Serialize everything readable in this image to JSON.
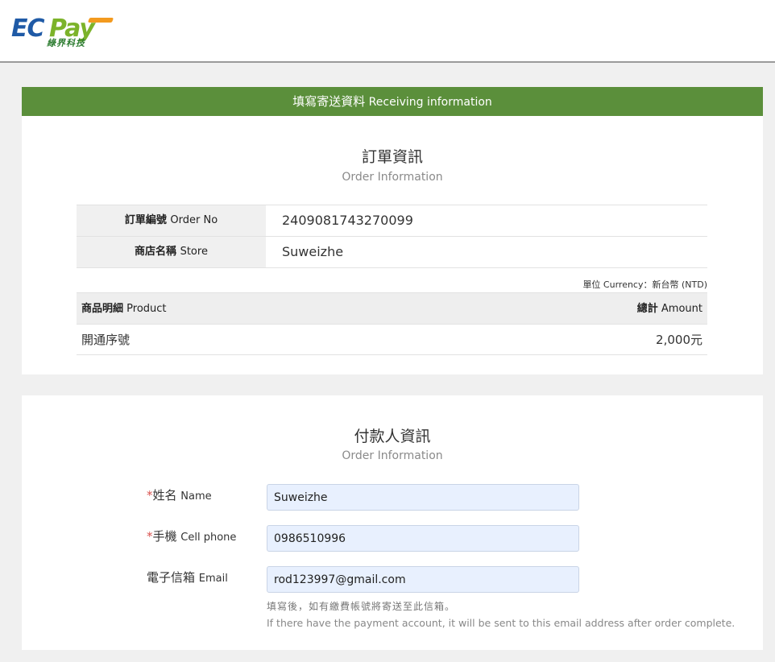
{
  "header": {
    "logo_ec": "EC",
    "logo_pay": "Pay",
    "logo_sub": "綠界科技"
  },
  "banner": {
    "zh": "填寫寄送資料",
    "en": "Receiving information"
  },
  "order_section": {
    "title": "訂單資訊",
    "subtitle": "Order Information",
    "rows": [
      {
        "label_zh": "訂單編號",
        "label_en": "Order No",
        "value": "2409081743270099"
      },
      {
        "label_zh": "商店名稱",
        "label_en": "Store",
        "value": "Suweizhe"
      }
    ],
    "currency_note": "單位 Currency：新台幣 (NTD)",
    "product_header": {
      "product_zh": "商品明細",
      "product_en": "Product",
      "amount_zh": "總計",
      "amount_en": "Amount"
    },
    "product_row": {
      "name": "開通序號",
      "amount": "2,000元"
    }
  },
  "payer_section": {
    "title": "付款人資訊",
    "subtitle": "Order Information",
    "fields": [
      {
        "required": "*",
        "label_zh": "姓名",
        "label_en": "Name",
        "value": "Suweizhe"
      },
      {
        "required": "*",
        "label_zh": "手機",
        "label_en": "Cell phone",
        "value": "0986510996"
      },
      {
        "required": "",
        "label_zh": "電子信箱",
        "label_en": "Email",
        "value": "rod123997@gmail.com"
      }
    ],
    "note_zh": "填寫後，如有繳費帳號將寄送至此信箱。",
    "note_en": "If there have the payment account, it will be sent to this email address after order complete."
  },
  "colors": {
    "banner_green": "#5b8f3b",
    "logo_blue": "#1f5aa6",
    "logo_green": "#7cb32a",
    "required_red": "#d9534f"
  }
}
